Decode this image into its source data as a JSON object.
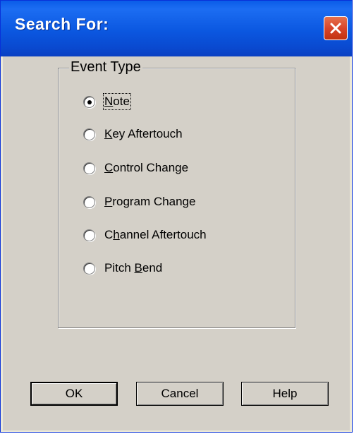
{
  "dialog": {
    "title": "Search For:"
  },
  "group": {
    "legend": "Event Type",
    "options": [
      {
        "pre": "",
        "mn": "N",
        "post": "ote",
        "selected": true
      },
      {
        "pre": "",
        "mn": "K",
        "post": "ey Aftertouch",
        "selected": false
      },
      {
        "pre": "",
        "mn": "C",
        "post": "ontrol Change",
        "selected": false
      },
      {
        "pre": "",
        "mn": "P",
        "post": "rogram Change",
        "selected": false
      },
      {
        "pre": "C",
        "mn": "h",
        "post": "annel Aftertouch",
        "selected": false
      },
      {
        "pre": "Pitch ",
        "mn": "B",
        "post": "end",
        "selected": false
      }
    ]
  },
  "buttons": {
    "ok": "OK",
    "cancel": "Cancel",
    "help": "Help"
  },
  "colors": {
    "titlebar": "#0a5ce8",
    "dialog_bg": "#d4d0c8",
    "close_button": "#d9452a"
  },
  "icons": {
    "close": "close-icon",
    "radio": "radio-button-icon"
  }
}
